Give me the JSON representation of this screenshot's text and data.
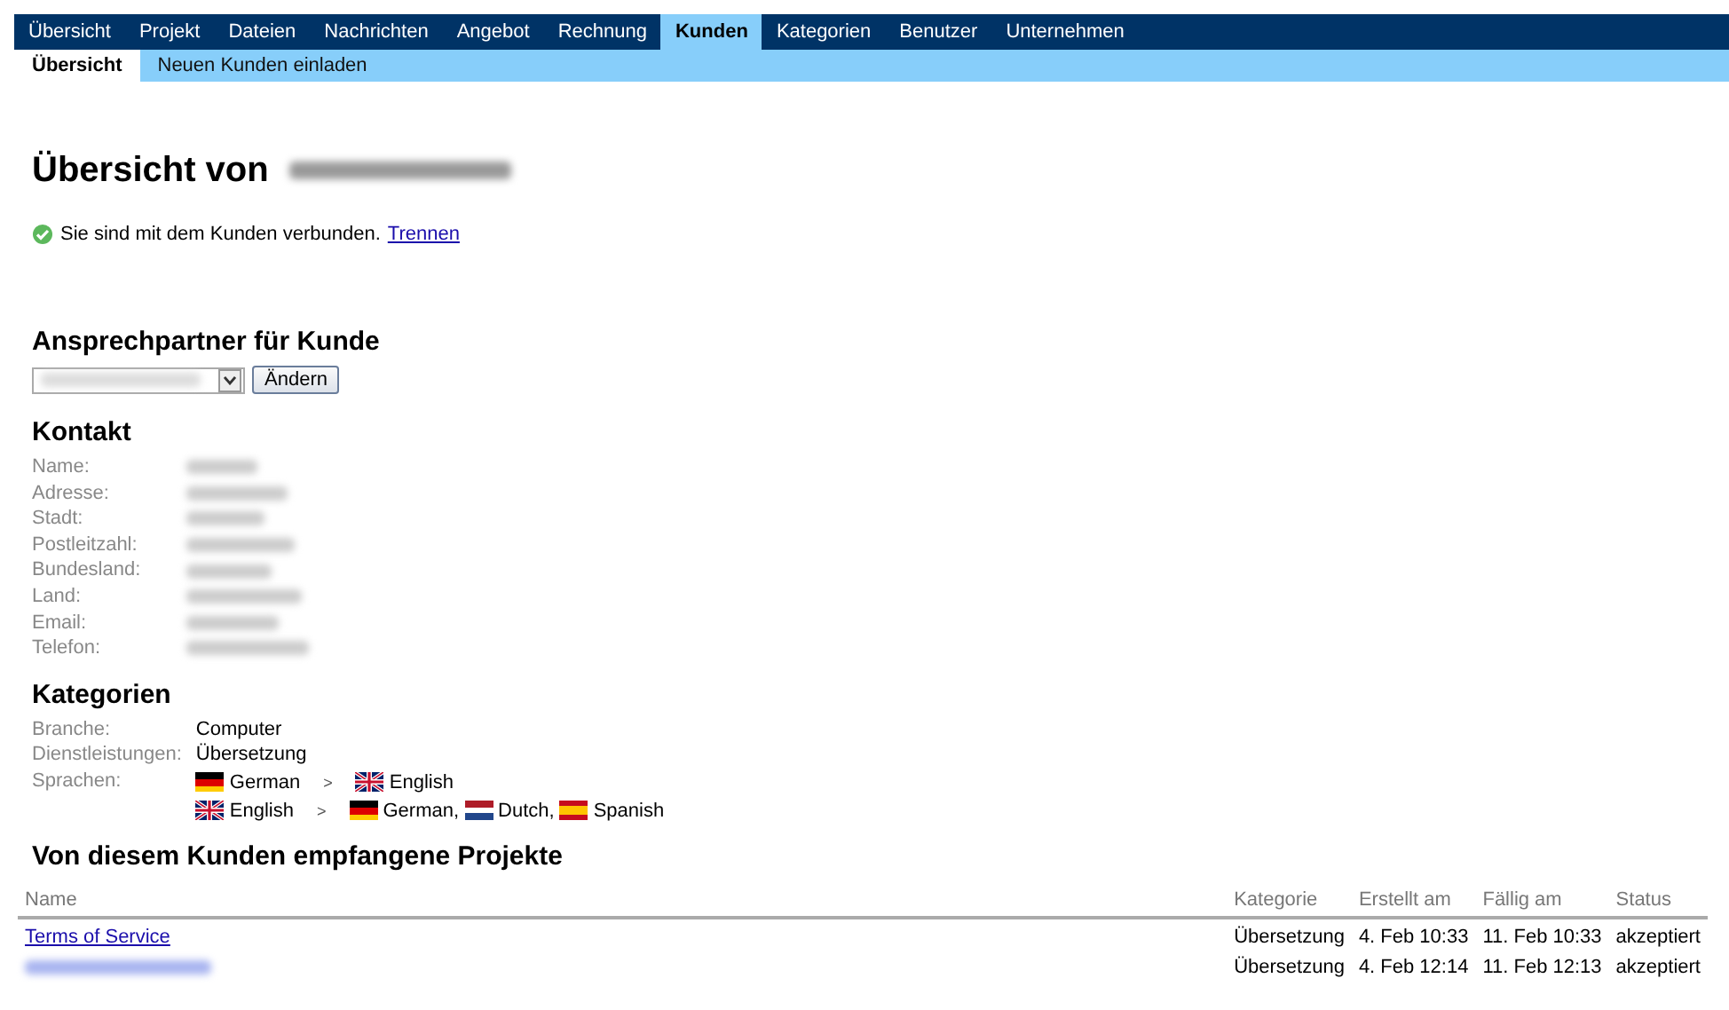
{
  "nav": {
    "tabs": [
      {
        "label": "Übersicht",
        "selected": false
      },
      {
        "label": "Projekt",
        "selected": false
      },
      {
        "label": "Dateien",
        "selected": false
      },
      {
        "label": "Nachrichten",
        "selected": false
      },
      {
        "label": "Angebot",
        "selected": false
      },
      {
        "label": "Rechnung",
        "selected": false
      },
      {
        "label": "Kunden",
        "selected": true
      },
      {
        "label": "Kategorien",
        "selected": false
      },
      {
        "label": "Benutzer",
        "selected": false
      },
      {
        "label": "Unternehmen",
        "selected": false
      }
    ]
  },
  "subnav": {
    "tabs": [
      {
        "label": "Übersicht",
        "selected": true
      },
      {
        "label": "Neuen Kunden einladen",
        "selected": false
      }
    ]
  },
  "title": {
    "text": "Übersicht von",
    "name_redacted": true
  },
  "status": {
    "text": "Sie sind mit dem Kunden verbunden.",
    "link": "Trennen"
  },
  "contact_person": {
    "heading": "Ansprechpartner für Kunde",
    "select_redacted": true,
    "button": "Ändern"
  },
  "contact": {
    "heading": "Kontakt",
    "fields": [
      {
        "label": "Name:",
        "value_redacted": true
      },
      {
        "label": "Adresse:",
        "value_redacted": true
      },
      {
        "label": "Stadt:",
        "value_redacted": true
      },
      {
        "label": "Postleitzahl:",
        "value_redacted": true
      },
      {
        "label": "Bundesland:",
        "value_redacted": true
      },
      {
        "label": "Land:",
        "value_redacted": true
      },
      {
        "label": "Email:",
        "value_redacted": true
      },
      {
        "label": "Telefon:",
        "value_redacted": true
      }
    ]
  },
  "categories": {
    "heading": "Kategorien",
    "fields": [
      {
        "label": "Branche:",
        "value": "Computer"
      },
      {
        "label": "Dienstleistungen:",
        "value": "Übersetzung"
      }
    ],
    "languages_label": "Sprachen:",
    "language_pairs": [
      {
        "source": {
          "kind": "de",
          "name": "German"
        },
        "arrow": ">",
        "targets": [
          {
            "kind": "gb",
            "name": "English"
          }
        ]
      },
      {
        "source": {
          "kind": "gb",
          "name": "English"
        },
        "arrow": ">",
        "targets": [
          {
            "kind": "de",
            "name": "German,"
          },
          {
            "kind": "nl",
            "name": "Dutch,"
          },
          {
            "kind": "es",
            "name": "Spanish"
          }
        ]
      }
    ]
  },
  "projects": {
    "heading": "Von diesem Kunden empfangene Projekte",
    "columns": [
      "Name",
      "Kategorie",
      "Erstellt am",
      "Fällig am",
      "Status"
    ],
    "rows": [
      {
        "name": "Terms of Service",
        "name_redacted": false,
        "category": "Übersetzung",
        "created": "4. Feb 10:33",
        "due": "11. Feb 10:33",
        "status": "akzeptiert"
      },
      {
        "name_redacted": true,
        "category": "Übersetzung",
        "created": "4. Feb 12:14",
        "due": "11. Feb 12:13",
        "status": "akzeptiert"
      }
    ]
  }
}
